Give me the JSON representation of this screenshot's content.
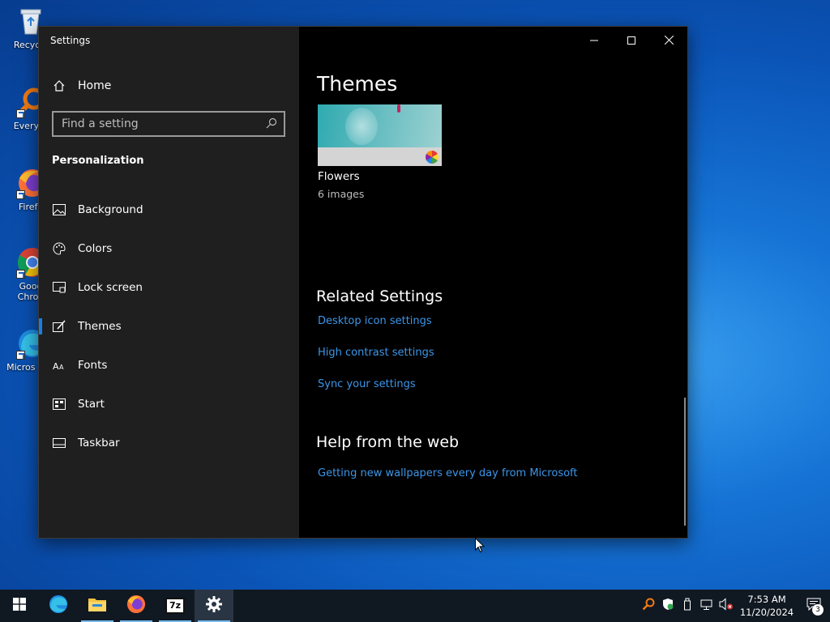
{
  "desktop": {
    "icons": [
      {
        "label": "Recycle",
        "icon": "recycle-bin-icon"
      },
      {
        "label": "Everyth",
        "icon": "everything-search-icon"
      },
      {
        "label": "Firefo",
        "icon": "firefox-icon"
      },
      {
        "label": "Goog Chron",
        "icon": "chrome-icon"
      },
      {
        "label": "Micros Edg",
        "icon": "edge-icon"
      }
    ]
  },
  "window": {
    "title": "Settings",
    "controls": {
      "minimize": "minimize-icon",
      "maximize": "maximize-icon",
      "close": "close-icon"
    }
  },
  "sidebar": {
    "home_label": "Home",
    "search": {
      "placeholder": "Find a setting",
      "value": ""
    },
    "section_label": "Personalization",
    "items": [
      {
        "label": "Background",
        "icon": "picture-icon",
        "active": false
      },
      {
        "label": "Colors",
        "icon": "palette-icon",
        "active": false
      },
      {
        "label": "Lock screen",
        "icon": "lock-screen-icon",
        "active": false
      },
      {
        "label": "Themes",
        "icon": "brush-icon",
        "active": true
      },
      {
        "label": "Fonts",
        "icon": "font-icon",
        "active": false
      },
      {
        "label": "Start",
        "icon": "start-icon",
        "active": false
      },
      {
        "label": "Taskbar",
        "icon": "taskbar-icon",
        "active": false
      }
    ]
  },
  "content": {
    "title": "Themes",
    "theme": {
      "name": "Flowers",
      "count": "6 images"
    },
    "related": {
      "heading": "Related Settings",
      "links": [
        "Desktop icon settings",
        "High contrast settings",
        "Sync your settings"
      ]
    },
    "help": {
      "heading": "Help from the web",
      "links": [
        "Getting new wallpapers every day from Microsoft"
      ]
    }
  },
  "taskbar": {
    "apps": [
      {
        "name": "start",
        "icon": "windows-start-icon"
      },
      {
        "name": "edge",
        "icon": "edge-icon"
      },
      {
        "name": "file-explorer",
        "icon": "folder-icon"
      },
      {
        "name": "firefox",
        "icon": "firefox-icon"
      },
      {
        "name": "7zip",
        "icon": "7zip-icon",
        "label": "7z"
      },
      {
        "name": "settings",
        "icon": "gear-icon"
      }
    ],
    "tray": {
      "time": "7:53 AM",
      "date": "11/20/2024",
      "notification_count": "3"
    }
  },
  "colors": {
    "accent": "#1a7ee0",
    "link": "#3c96e8",
    "sidebar_bg": "#1f1f1f",
    "content_bg": "#000000"
  }
}
